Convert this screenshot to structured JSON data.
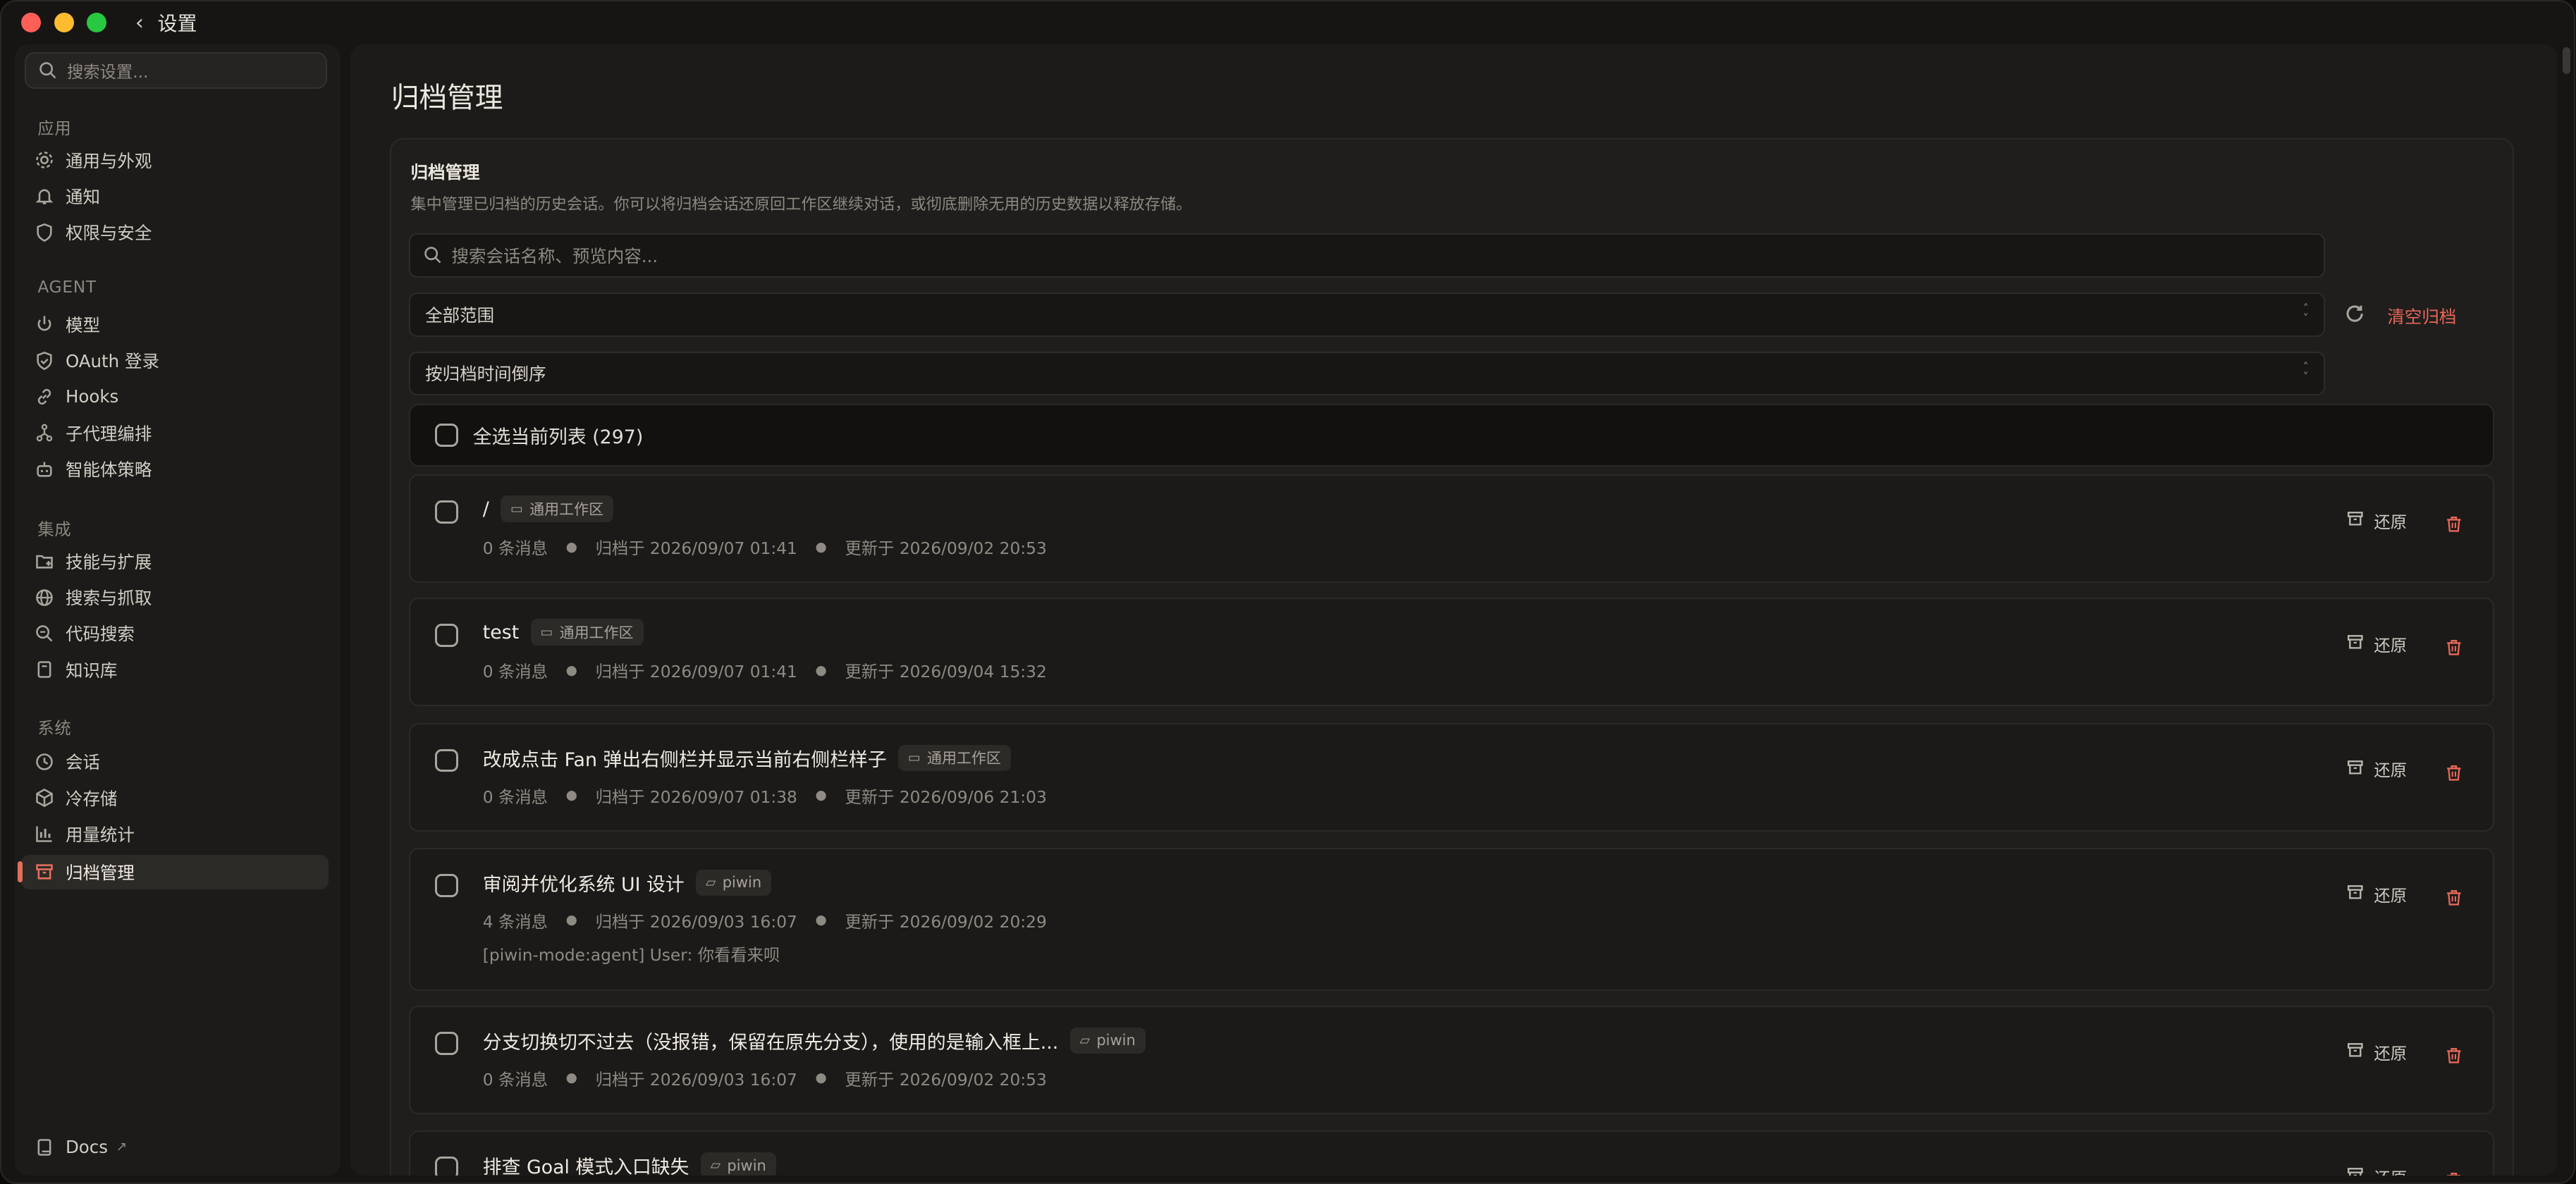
{
  "window": {
    "title": "设置"
  },
  "sidebar": {
    "search_placeholder": "搜索设置...",
    "sections": [
      {
        "label": "应用",
        "items": [
          {
            "label": "通用与外观",
            "icon": "gear-icon"
          },
          {
            "label": "通知",
            "icon": "bell-icon"
          },
          {
            "label": "权限与安全",
            "icon": "shield-icon"
          }
        ]
      },
      {
        "label": "AGENT",
        "items": [
          {
            "label": "模型",
            "icon": "power-icon"
          },
          {
            "label": "OAuth 登录",
            "icon": "shield-check-icon"
          },
          {
            "label": "Hooks",
            "icon": "link-icon"
          },
          {
            "label": "子代理编排",
            "icon": "fork-icon"
          },
          {
            "label": "智能体策略",
            "icon": "bot-icon"
          }
        ]
      },
      {
        "label": "集成",
        "items": [
          {
            "label": "技能与扩展",
            "icon": "folder-plus-icon"
          },
          {
            "label": "搜索与抓取",
            "icon": "globe-icon"
          },
          {
            "label": "代码搜索",
            "icon": "code-search-icon"
          },
          {
            "label": "知识库",
            "icon": "book-icon"
          }
        ]
      },
      {
        "label": "系统",
        "items": [
          {
            "label": "会话",
            "icon": "history-icon"
          },
          {
            "label": "冷存储",
            "icon": "box-icon"
          },
          {
            "label": "用量统计",
            "icon": "bar-chart-icon"
          },
          {
            "label": "归档管理",
            "icon": "archive-icon",
            "active": true
          }
        ]
      }
    ],
    "docs": {
      "label": "Docs",
      "icon": "book-icon",
      "ext": "↗"
    }
  },
  "main": {
    "page_title": "归档管理",
    "card": {
      "title": "归档管理",
      "description": "集中管理已归档的历史会话。你可以将归档会话还原回工作区继续对话，或彻底删除无用的历史数据以释放存储。",
      "search_placeholder": "搜索会话名称、预览内容...",
      "scope_select": "全部范围",
      "sort_select": "按归档时间倒序",
      "clear_label": "清空归档",
      "select_all": "全选当前列表 (297)",
      "restore_label": "还原",
      "rows": [
        {
          "title": "/",
          "tag": "通用工作区",
          "tag_icon": "chat-icon",
          "messages": "0 条消息",
          "archived": "归档于 2026/09/07 01:41",
          "updated": "更新于 2026/09/02 20:53",
          "preview": ""
        },
        {
          "title": "test",
          "tag": "通用工作区",
          "tag_icon": "chat-icon",
          "messages": "0 条消息",
          "archived": "归档于 2026/09/07 01:41",
          "updated": "更新于 2026/09/04 15:32",
          "preview": ""
        },
        {
          "title": "改成点击 Fan 弹出右侧栏并显示当前右侧栏样子",
          "tag": "通用工作区",
          "tag_icon": "chat-icon",
          "messages": "0 条消息",
          "archived": "归档于 2026/09/07 01:38",
          "updated": "更新于 2026/09/06 21:03",
          "preview": ""
        },
        {
          "title": "审阅并优化系统 UI 设计",
          "tag": "piwin",
          "tag_icon": "folder-icon",
          "messages": "4 条消息",
          "archived": "归档于 2026/09/03 16:07",
          "updated": "更新于 2026/09/02 20:29",
          "preview": "[piwin-mode:agent] User: 你看看来呗"
        },
        {
          "title": "分支切换切不过去（没报错，保留在原先分支），使用的是输入框上...",
          "tag": "piwin",
          "tag_icon": "folder-icon",
          "messages": "0 条消息",
          "archived": "归档于 2026/09/03 16:07",
          "updated": "更新于 2026/09/02 20:53",
          "preview": ""
        },
        {
          "title": "排查 Goal 模式入口缺失",
          "tag": "piwin",
          "tag_icon": "folder-icon",
          "messages": "",
          "archived": "",
          "updated": "",
          "preview": ""
        }
      ]
    }
  },
  "colors": {
    "accent": "#e46f5b",
    "danger": "#e8675a",
    "background": "#161514",
    "panel": "#1c1b19"
  }
}
